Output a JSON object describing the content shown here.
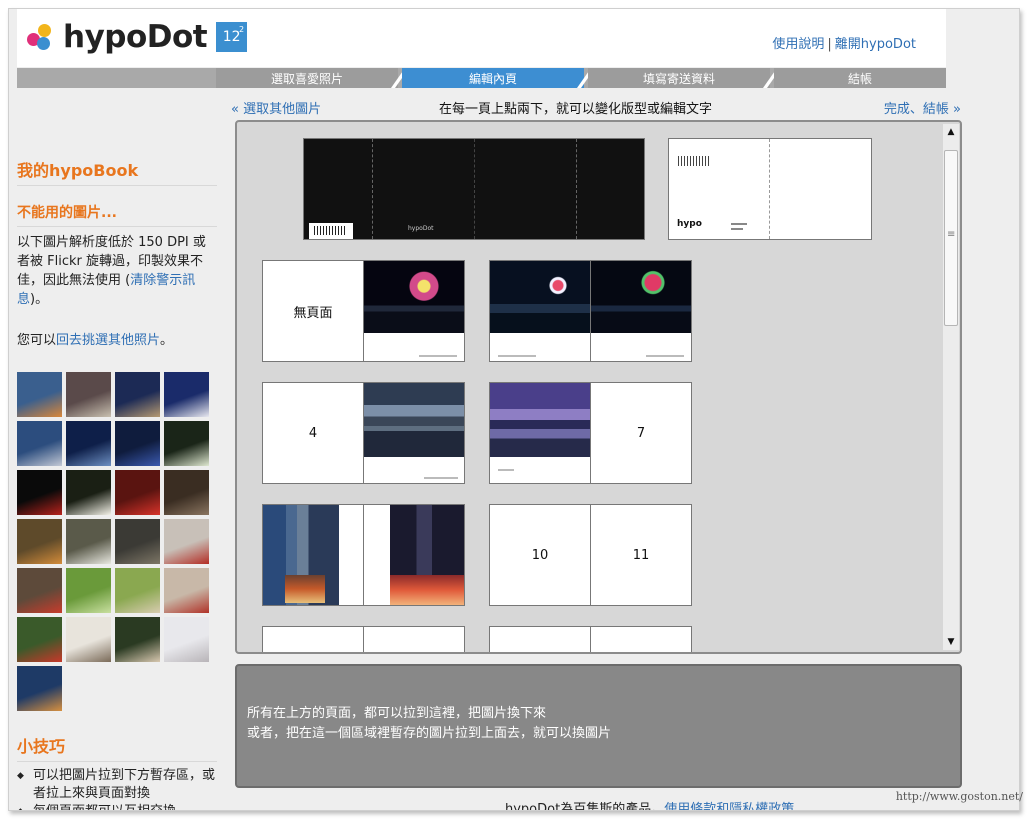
{
  "brand": {
    "name": "hypoDot",
    "badge": "12",
    "badge_sup": "2"
  },
  "top_links": {
    "help": "使用說明",
    "sep": "|",
    "leave": "離開hypoDot"
  },
  "steps": [
    {
      "label": "選取喜愛照片",
      "active": false
    },
    {
      "label": "編輯內頁",
      "active": true
    },
    {
      "label": "填寫寄送資料",
      "active": false
    },
    {
      "label": "結帳",
      "active": false
    }
  ],
  "subbar": {
    "back": "« 選取其他圖片",
    "hint": "在每一頁上點兩下，就可以變化版型或編輯文字",
    "next": "完成、結帳 »"
  },
  "left": {
    "title": "我的hypoBook",
    "unusable_title": "不能用的圖片...",
    "unusable_text": "以下圖片解析度低於 150 DPI 或者被 Flickr 旋轉過，印製效果不佳，因此無法使用 (",
    "clear_link": "清除警示訊息",
    "unusable_end": ")。",
    "pick_prefix": "您可以",
    "pick_link": "回去挑選其他照片",
    "pick_end": "。",
    "tips_title": "小技巧",
    "tips": [
      "可以把圖片拉到下方暫存區，或者拉上來與頁面對換",
      "每個頁面都可以互相交換"
    ]
  },
  "thumb_colors": [
    [
      "#3a5f8e",
      "#d9873a"
    ],
    [
      "#5a4a4a",
      "#c9c0b0"
    ],
    [
      "#1c2a55",
      "#b69a72"
    ],
    [
      "#1a2b6a",
      "#e8e8f0"
    ],
    [
      "#2c4d7e",
      "#c3c9d6"
    ],
    [
      "#0e1f49",
      "#6d8fc2"
    ],
    [
      "#0f1c3d",
      "#3b5ab0"
    ],
    [
      "#1a2518",
      "#dfe8d0"
    ],
    [
      "#0a0a0a",
      "#b8221c"
    ],
    [
      "#1a1f14",
      "#f4f2e8"
    ],
    [
      "#5a1410",
      "#d8332a"
    ],
    [
      "#3a2d22",
      "#8a7560"
    ],
    [
      "#5e4a2a",
      "#d38c3a"
    ],
    [
      "#5a5a4a",
      "#e8e8e0"
    ],
    [
      "#3b3a35",
      "#7d7666"
    ],
    [
      "#c8c0b8",
      "#b32c24"
    ],
    [
      "#5d4a3a",
      "#c83c2c"
    ],
    [
      "#6a9a3a",
      "#c9e0a0"
    ],
    [
      "#8aa850",
      "#d8ccb0"
    ],
    [
      "#c8b8a8",
      "#b03228"
    ],
    [
      "#3a5a2a",
      "#c8382a"
    ],
    [
      "#e8e4dc",
      "#7a6a58"
    ],
    [
      "#2a3a22",
      "#d8c8b0"
    ],
    [
      "#e8e8ec",
      "#b8b4b8"
    ],
    [
      "#1e3a66",
      "#d69040"
    ]
  ],
  "pages": {
    "no_page": "無頁面",
    "p4": "4",
    "p7": "7",
    "p10": "10",
    "p11": "11",
    "cover_brand": "hypo",
    "cover_mark": "hypoDot"
  },
  "staging": {
    "line1": "所有在上方的頁面，都可以拉到這裡，把圖片換下來",
    "line2": "或者，把在這一個區域裡暫存的圖片拉到上面去，就可以換圖片"
  },
  "footer": {
    "text": "hypoDot為百集斯的產品。",
    "link": "使用條款和隱私權政策"
  },
  "watermark": "http://www.goston.net/",
  "colors": {
    "accent_orange": "#e8761e",
    "link_blue": "#2f6fb4",
    "step_active": "#3d8ed2",
    "logo_pink": "#e0307a",
    "logo_blue": "#3b8fd0",
    "logo_yellow": "#f2b51b"
  }
}
